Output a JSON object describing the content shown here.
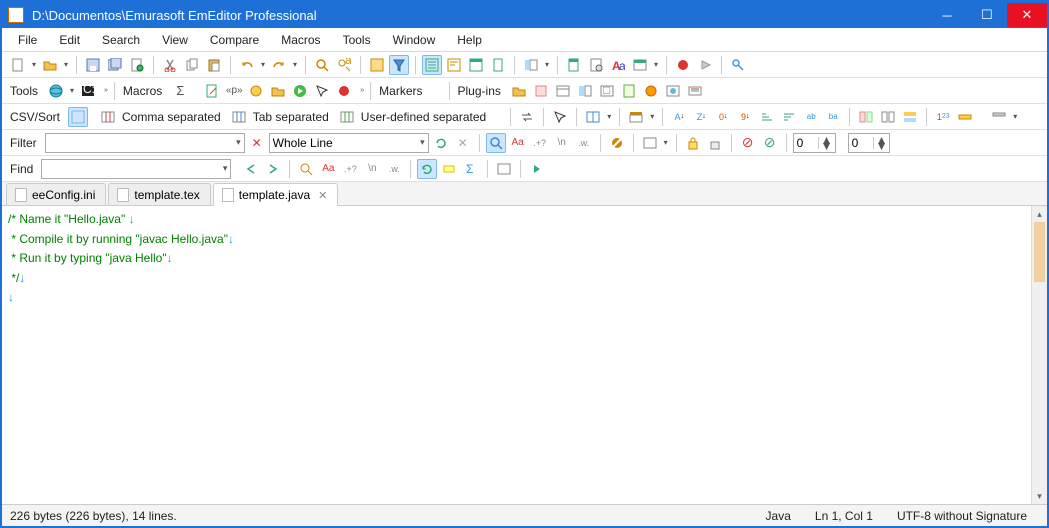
{
  "title": "D:\\Documentos\\Emurasoft EmEditor Professional",
  "menu": [
    "File",
    "Edit",
    "Search",
    "View",
    "Compare",
    "Macros",
    "Tools",
    "Window",
    "Help"
  ],
  "tb2": {
    "tools": "Tools",
    "macros": "Macros",
    "markers": "Markers",
    "plugins": "Plug-ins"
  },
  "tb3": {
    "csv": "CSV/Sort",
    "comma": "Comma separated",
    "tab": "Tab separated",
    "user": "User-defined separated"
  },
  "tb4": {
    "filter": "Filter",
    "whole": "Whole Line",
    "zero1": "0",
    "zero2": "0"
  },
  "tb5": {
    "find": "Find"
  },
  "tabs": [
    {
      "name": "eeConfig.ini",
      "active": false
    },
    {
      "name": "template.tex",
      "active": false
    },
    {
      "name": "template.java",
      "active": true
    }
  ],
  "code": {
    "l1": "/* Name it \"Hello.java\" ",
    "l2": " * Compile it by running \"javac Hello.java\"",
    "l3": " * Run it by typing \"java Hello\"",
    "l4": " */",
    "ret": "↓"
  },
  "status": {
    "left": "226 bytes (226 bytes), 14 lines.",
    "lang": "Java",
    "pos": "Ln 1, Col 1",
    "enc": "UTF-8 without Signature"
  }
}
